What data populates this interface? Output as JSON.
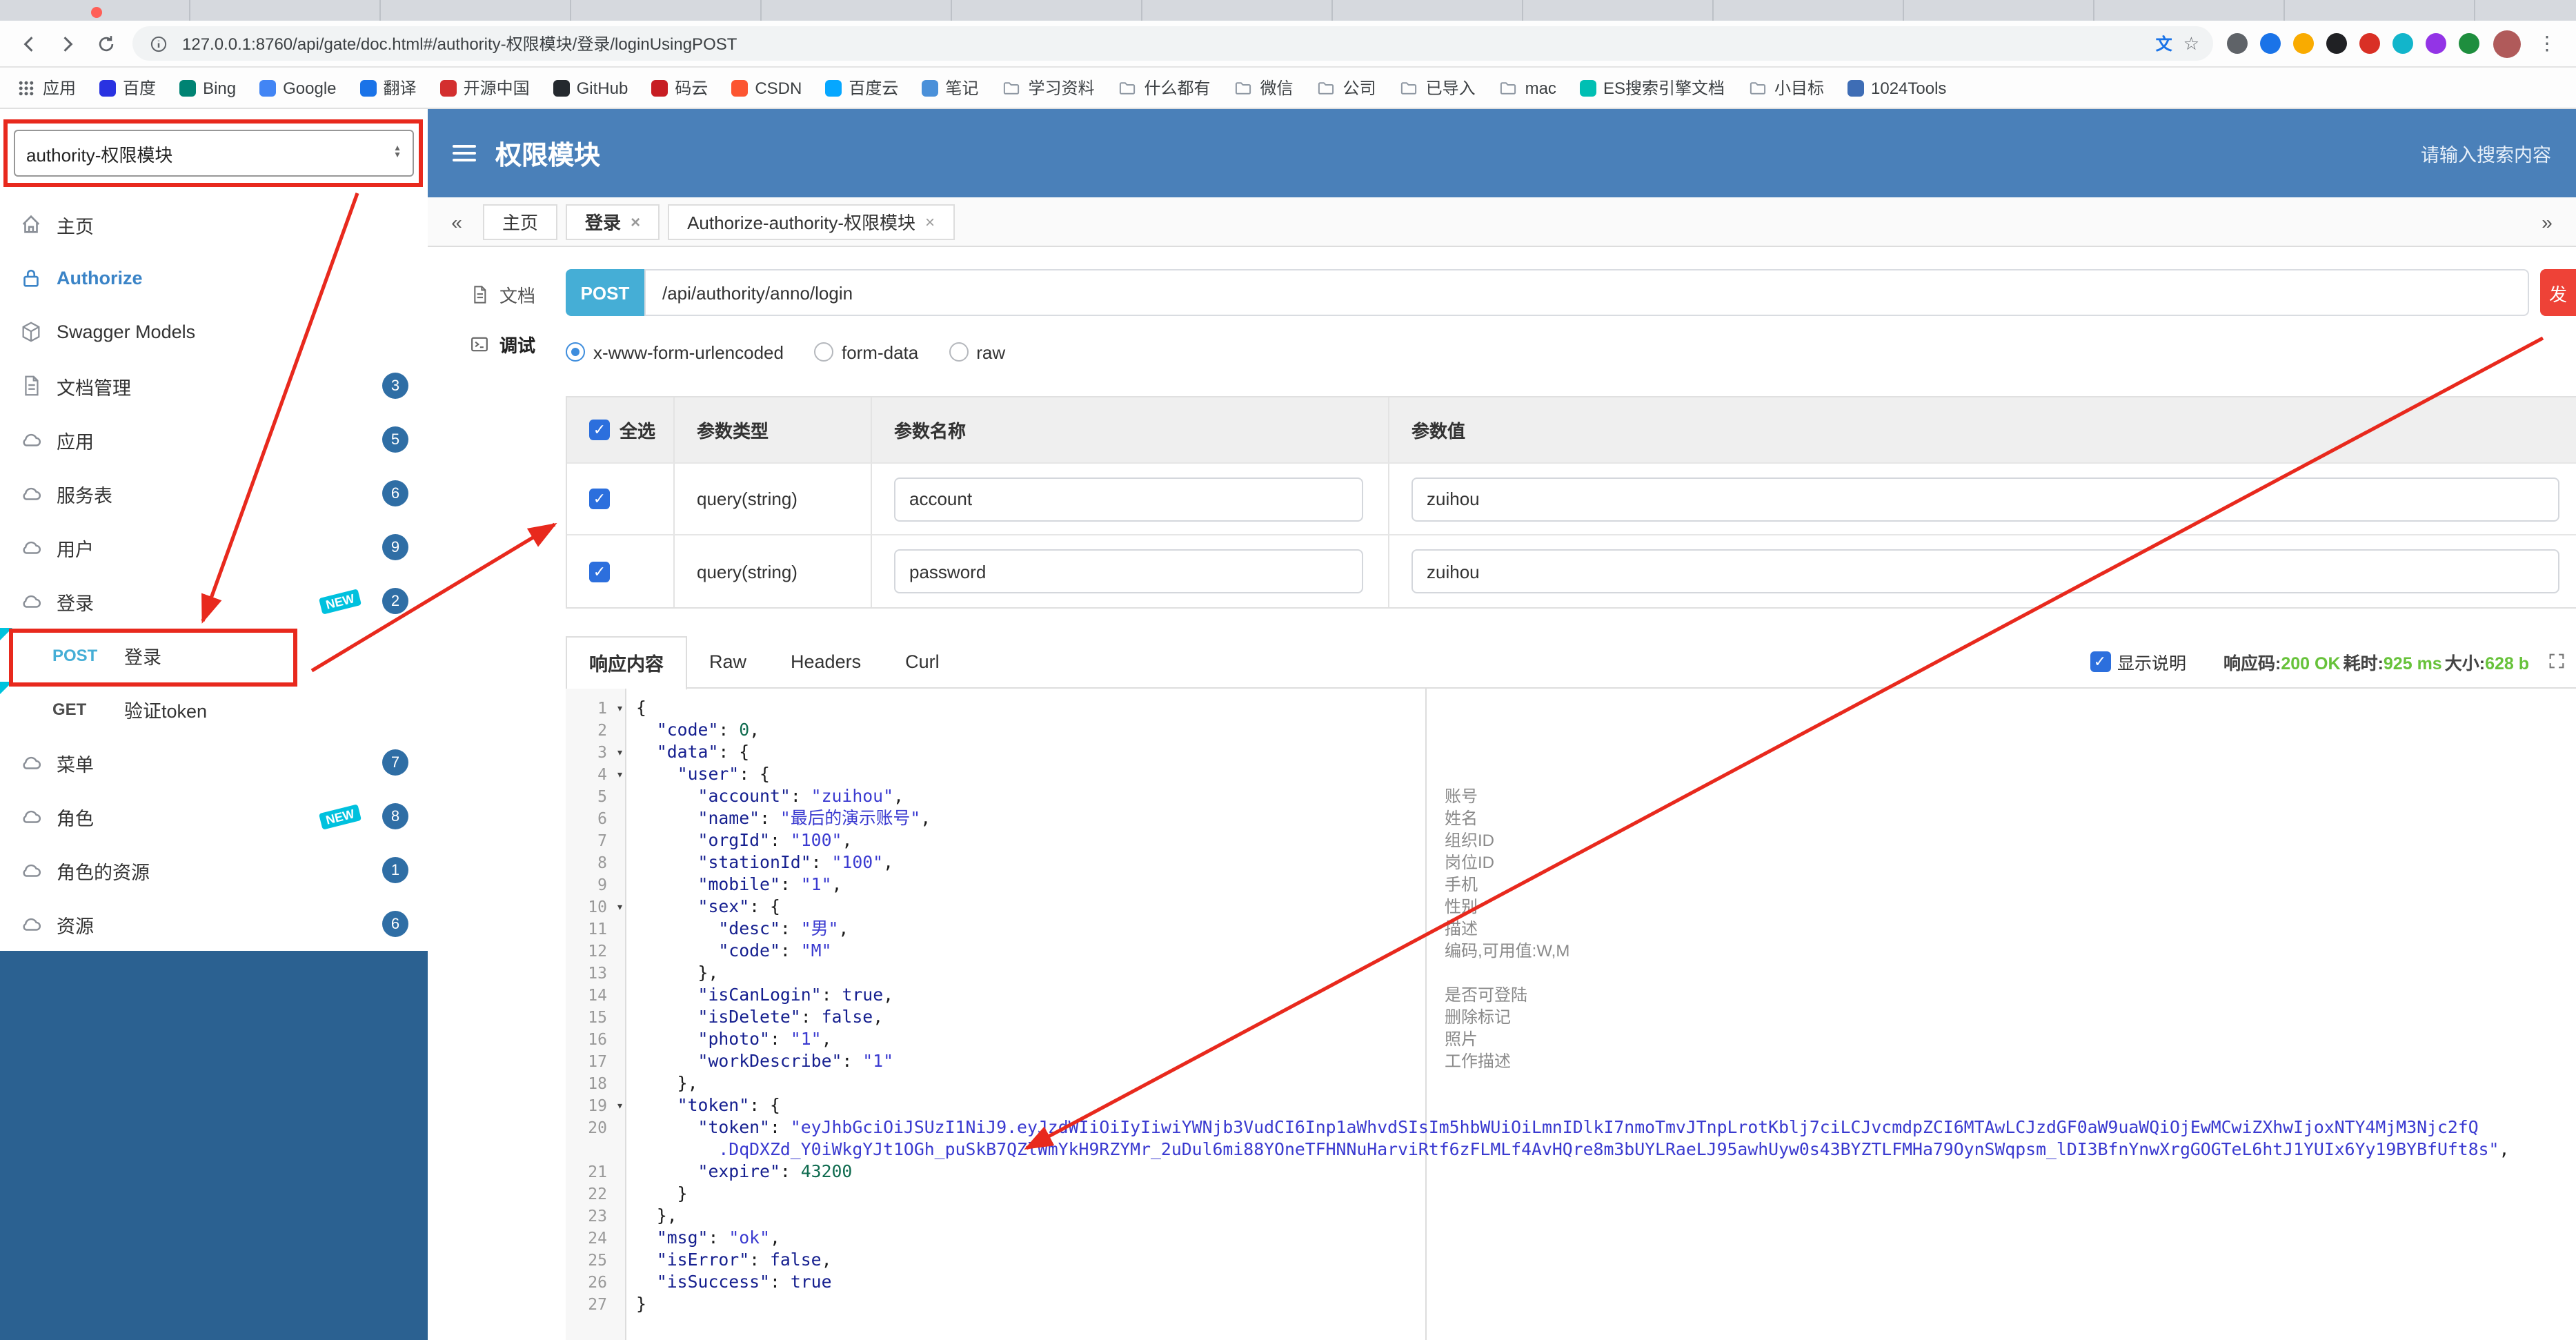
{
  "browser": {
    "url": "127.0.0.1:8760/api/gate/doc.html#/authority-权限模块/登录/loginUsingPOST",
    "extension_icon_colors": [
      "#5f6368",
      "#1a73e8",
      "#f9ab00",
      "#202124",
      "#d93025",
      "#12b5cb",
      "#9334e6",
      "#1e8e3e"
    ],
    "bookmarks": [
      {
        "label": "应用",
        "icon": "apps-grid-icon"
      },
      {
        "label": "百度",
        "icon": "favicon",
        "color": "#2932e1"
      },
      {
        "label": "Bing",
        "icon": "favicon",
        "color": "#008373"
      },
      {
        "label": "Google",
        "icon": "favicon",
        "color": "#4285f4"
      },
      {
        "label": "翻译",
        "icon": "favicon",
        "color": "#1a73e8"
      },
      {
        "label": "开源中国",
        "icon": "favicon",
        "color": "#d32f2f"
      },
      {
        "label": "GitHub",
        "icon": "favicon",
        "color": "#24292e"
      },
      {
        "label": "码云",
        "icon": "favicon",
        "color": "#c71d23"
      },
      {
        "label": "CSDN",
        "icon": "favicon",
        "color": "#fc5531"
      },
      {
        "label": "百度云",
        "icon": "favicon",
        "color": "#06a7ff"
      },
      {
        "label": "笔记",
        "icon": "favicon",
        "color": "#4a90d9"
      },
      {
        "label": "学习资料",
        "icon": "folder-icon"
      },
      {
        "label": "什么都有",
        "icon": "folder-icon"
      },
      {
        "label": "微信",
        "icon": "folder-icon"
      },
      {
        "label": "公司",
        "icon": "folder-icon"
      },
      {
        "label": "已导入",
        "icon": "folder-icon"
      },
      {
        "label": "mac",
        "icon": "folder-icon"
      },
      {
        "label": "ES搜索引擎文档",
        "icon": "favicon",
        "color": "#00bfb3"
      },
      {
        "label": "小目标",
        "icon": "folder-icon"
      },
      {
        "label": "1024Tools",
        "icon": "favicon",
        "color": "#3e6db5"
      }
    ]
  },
  "header": {
    "group_select": "authority-权限模块",
    "title": "权限模块",
    "search_placeholder": "请输入搜索内容"
  },
  "sidebar": {
    "new_tag": "NEW",
    "items": [
      {
        "id": "home",
        "label": "主页",
        "icon": "home-icon"
      },
      {
        "id": "authorize",
        "label": "Authorize",
        "icon": "lock-icon",
        "accent": true
      },
      {
        "id": "swagger-models",
        "label": "Swagger Models",
        "icon": "models-icon"
      },
      {
        "id": "docs",
        "label": "文档管理",
        "icon": "docs-icon",
        "badge": "3"
      },
      {
        "id": "app",
        "label": "应用",
        "icon": "api-group-icon",
        "badge": "5"
      },
      {
        "id": "service",
        "label": "服务表",
        "icon": "api-group-icon",
        "badge": "6"
      },
      {
        "id": "user",
        "label": "用户",
        "icon": "api-group-icon",
        "badge": "9"
      },
      {
        "id": "login",
        "label": "登录",
        "icon": "api-group-icon",
        "badge": "2",
        "new": true,
        "children": [
          {
            "id": "login-post",
            "method": "POST",
            "label": "登录",
            "marker": true
          },
          {
            "id": "verify-token-get",
            "method": "GET",
            "label": "验证token",
            "marker": true
          }
        ]
      },
      {
        "id": "menu",
        "label": "菜单",
        "icon": "api-group-icon",
        "badge": "7"
      },
      {
        "id": "role",
        "label": "角色",
        "icon": "api-group-icon",
        "badge": "8",
        "new": true
      },
      {
        "id": "role-resource",
        "label": "角色的资源",
        "icon": "api-group-icon",
        "badge": "1"
      },
      {
        "id": "resource",
        "label": "资源",
        "icon": "api-group-icon",
        "badge": "6"
      }
    ]
  },
  "tabs": {
    "scroll_left": "«",
    "scroll_right": "»",
    "items": [
      {
        "label": "主页",
        "closable": false
      },
      {
        "label": "登录",
        "closable": true,
        "active": true
      },
      {
        "label": "Authorize-authority-权限模块",
        "closable": true
      }
    ]
  },
  "doc_tabs": {
    "items": [
      {
        "label": "文档",
        "icon": "doc-tab-icon"
      },
      {
        "label": "调试",
        "icon": "debug-icon",
        "active": true
      }
    ]
  },
  "request": {
    "method": "POST",
    "url": "/api/authority/anno/login",
    "send_label": "发",
    "content_types": [
      {
        "label": "x-www-form-urlencoded",
        "selected": true
      },
      {
        "label": "form-data",
        "selected": false
      },
      {
        "label": "raw",
        "selected": false
      }
    ]
  },
  "params": {
    "headers": [
      "全选",
      "参数类型",
      "参数名称",
      "参数值"
    ],
    "rows": [
      {
        "checked": true,
        "type": "query(string)",
        "name": "account",
        "value": "zuihou"
      },
      {
        "checked": true,
        "type": "query(string)",
        "name": "password",
        "value": "zuihou"
      }
    ]
  },
  "response": {
    "tabs": [
      {
        "label": "响应内容",
        "active": true
      },
      {
        "label": "Raw",
        "active": false
      },
      {
        "label": "Headers",
        "active": false
      },
      {
        "label": "Curl",
        "active": false
      }
    ],
    "show_desc_label": "显示说明",
    "show_desc_checked": true,
    "meta": [
      {
        "label": "响应码:",
        "value": "200 OK"
      },
      {
        "label": "耗时:",
        "value": "925 ms"
      },
      {
        "label": "大小:",
        "value": "628 b"
      }
    ],
    "code": {
      "lines": [
        {
          "n": "1",
          "fold": true,
          "seg": [
            [
              "{",
              "p"
            ]
          ]
        },
        {
          "n": "2",
          "seg": [
            [
              "  ",
              "p"
            ],
            [
              "\"code\"",
              "k"
            ],
            [
              ": ",
              "p"
            ],
            [
              "0",
              "n"
            ],
            [
              ",",
              "p"
            ]
          ]
        },
        {
          "n": "3",
          "fold": true,
          "seg": [
            [
              "  ",
              "p"
            ],
            [
              "\"data\"",
              "k"
            ],
            [
              ": {",
              "p"
            ]
          ]
        },
        {
          "n": "4",
          "fold": true,
          "seg": [
            [
              "    ",
              "p"
            ],
            [
              "\"user\"",
              "k"
            ],
            [
              ": {",
              "p"
            ]
          ]
        },
        {
          "n": "5",
          "seg": [
            [
              "      ",
              "p"
            ],
            [
              "\"account\"",
              "k"
            ],
            [
              ": ",
              "p"
            ],
            [
              "\"zuihou\"",
              "s"
            ],
            [
              ",",
              "p"
            ]
          ]
        },
        {
          "n": "6",
          "seg": [
            [
              "      ",
              "p"
            ],
            [
              "\"name\"",
              "k"
            ],
            [
              ": ",
              "p"
            ],
            [
              "\"最后的演示账号\"",
              "s"
            ],
            [
              ",",
              "p"
            ]
          ]
        },
        {
          "n": "7",
          "seg": [
            [
              "      ",
              "p"
            ],
            [
              "\"orgId\"",
              "k"
            ],
            [
              ": ",
              "p"
            ],
            [
              "\"100\"",
              "s"
            ],
            [
              ",",
              "p"
            ]
          ]
        },
        {
          "n": "8",
          "seg": [
            [
              "      ",
              "p"
            ],
            [
              "\"stationId\"",
              "k"
            ],
            [
              ": ",
              "p"
            ],
            [
              "\"100\"",
              "s"
            ],
            [
              ",",
              "p"
            ]
          ]
        },
        {
          "n": "9",
          "seg": [
            [
              "      ",
              "p"
            ],
            [
              "\"mobile\"",
              "k"
            ],
            [
              ": ",
              "p"
            ],
            [
              "\"1\"",
              "s"
            ],
            [
              ",",
              "p"
            ]
          ]
        },
        {
          "n": "10",
          "fold": true,
          "seg": [
            [
              "      ",
              "p"
            ],
            [
              "\"sex\"",
              "k"
            ],
            [
              ": {",
              "p"
            ]
          ]
        },
        {
          "n": "11",
          "seg": [
            [
              "        ",
              "p"
            ],
            [
              "\"desc\"",
              "k"
            ],
            [
              ": ",
              "p"
            ],
            [
              "\"男\"",
              "s"
            ],
            [
              ",",
              "p"
            ]
          ]
        },
        {
          "n": "12",
          "seg": [
            [
              "        ",
              "p"
            ],
            [
              "\"code\"",
              "k"
            ],
            [
              ": ",
              "p"
            ],
            [
              "\"M\"",
              "s"
            ]
          ]
        },
        {
          "n": "13",
          "seg": [
            [
              "      },",
              "p"
            ]
          ]
        },
        {
          "n": "14",
          "seg": [
            [
              "      ",
              "p"
            ],
            [
              "\"isCanLogin\"",
              "k"
            ],
            [
              ": ",
              "p"
            ],
            [
              "true",
              "b"
            ],
            [
              ",",
              "p"
            ]
          ]
        },
        {
          "n": "15",
          "seg": [
            [
              "      ",
              "p"
            ],
            [
              "\"isDelete\"",
              "k"
            ],
            [
              ": ",
              "p"
            ],
            [
              "false",
              "b"
            ],
            [
              ",",
              "p"
            ]
          ]
        },
        {
          "n": "16",
          "seg": [
            [
              "      ",
              "p"
            ],
            [
              "\"photo\"",
              "k"
            ],
            [
              ": ",
              "p"
            ],
            [
              "\"1\"",
              "s"
            ],
            [
              ",",
              "p"
            ]
          ]
        },
        {
          "n": "17",
          "seg": [
            [
              "      ",
              "p"
            ],
            [
              "\"workDescribe\"",
              "k"
            ],
            [
              ": ",
              "p"
            ],
            [
              "\"1\"",
              "s"
            ]
          ]
        },
        {
          "n": "18",
          "seg": [
            [
              "    },",
              "p"
            ]
          ]
        },
        {
          "n": "19",
          "fold": true,
          "seg": [
            [
              "    ",
              "p"
            ],
            [
              "\"token\"",
              "k"
            ],
            [
              ": {",
              "p"
            ]
          ]
        },
        {
          "n": "20",
          "seg": [
            [
              "      ",
              "p"
            ],
            [
              "\"token\"",
              "k"
            ],
            [
              ": ",
              "p"
            ],
            [
              "\"eyJhbGciOiJSUzI1NiJ9.eyJzdWIiOiIyIiwiYWNjb3VudCI6Inp1aWhvdSIsIm5hbWUiOiLmnIDlkI7nmoTmvJTnpLrotKblj7ciLCJvcmdpZCI6MTAwLCJzdGF0aW9uaWQiOjEwMCwiZXhwIjoxNTY4MjM3Njc2fQ",
              "s"
            ]
          ]
        },
        {
          "n": "",
          "seg": [
            [
              "        ",
              "p"
            ],
            [
              ".DqDXZd_Y0iWkgYJt1OGh_puSkB7QZlWmYkH9RZYMr_2uDul6mi88YOneTFHNNuHarviRtf6zFLMLf4AvHQre8m3bUYLRaeLJ95awhUyw0s43BYZTLFMHa79OynSWqpsm_lDI3BfnYnwXrgGOGTeL6htJ1YUIx6Yy19BYBfUft8s\"",
              "s"
            ],
            [
              ",",
              "p"
            ]
          ]
        },
        {
          "n": "21",
          "seg": [
            [
              "      ",
              "p"
            ],
            [
              "\"expire\"",
              "k"
            ],
            [
              ": ",
              "p"
            ],
            [
              "43200",
              "n"
            ]
          ]
        },
        {
          "n": "22",
          "seg": [
            [
              "    }",
              "p"
            ]
          ]
        },
        {
          "n": "23",
          "seg": [
            [
              "  },",
              "p"
            ]
          ]
        },
        {
          "n": "24",
          "seg": [
            [
              "  ",
              "p"
            ],
            [
              "\"msg\"",
              "k"
            ],
            [
              ": ",
              "p"
            ],
            [
              "\"ok\"",
              "s"
            ],
            [
              ",",
              "p"
            ]
          ]
        },
        {
          "n": "25",
          "seg": [
            [
              "  ",
              "p"
            ],
            [
              "\"isError\"",
              "k"
            ],
            [
              ": ",
              "p"
            ],
            [
              "false",
              "b"
            ],
            [
              ",",
              "p"
            ]
          ]
        },
        {
          "n": "26",
          "seg": [
            [
              "  ",
              "p"
            ],
            [
              "\"isSuccess\"",
              "k"
            ],
            [
              ": ",
              "p"
            ],
            [
              "true",
              "b"
            ]
          ]
        },
        {
          "n": "27",
          "seg": [
            [
              "}",
              "p"
            ]
          ]
        }
      ],
      "annotations": [
        {
          "line": 5,
          "text": "账号"
        },
        {
          "line": 6,
          "text": "姓名"
        },
        {
          "line": 7,
          "text": "组织ID"
        },
        {
          "line": 8,
          "text": "岗位ID"
        },
        {
          "line": 9,
          "text": "手机"
        },
        {
          "line": 10,
          "text": "性别"
        },
        {
          "line": 11,
          "text": "描述"
        },
        {
          "line": 12,
          "text": "编码,可用值:W,M"
        },
        {
          "line": 14,
          "text": "是否可登陆"
        },
        {
          "line": 15,
          "text": "删除标记"
        },
        {
          "line": 16,
          "text": "照片"
        },
        {
          "line": 17,
          "text": "工作描述"
        }
      ]
    }
  },
  "colors": {
    "header_blue": "#4a80b9",
    "sidebar_fill_blue": "#2b6191",
    "post_badge_blue": "#45aed6",
    "send_button_red": "#ee4237",
    "success_green": "#67c23a",
    "annotation_red": "#e8291d",
    "new_tag_cyan": "#00c1de"
  }
}
